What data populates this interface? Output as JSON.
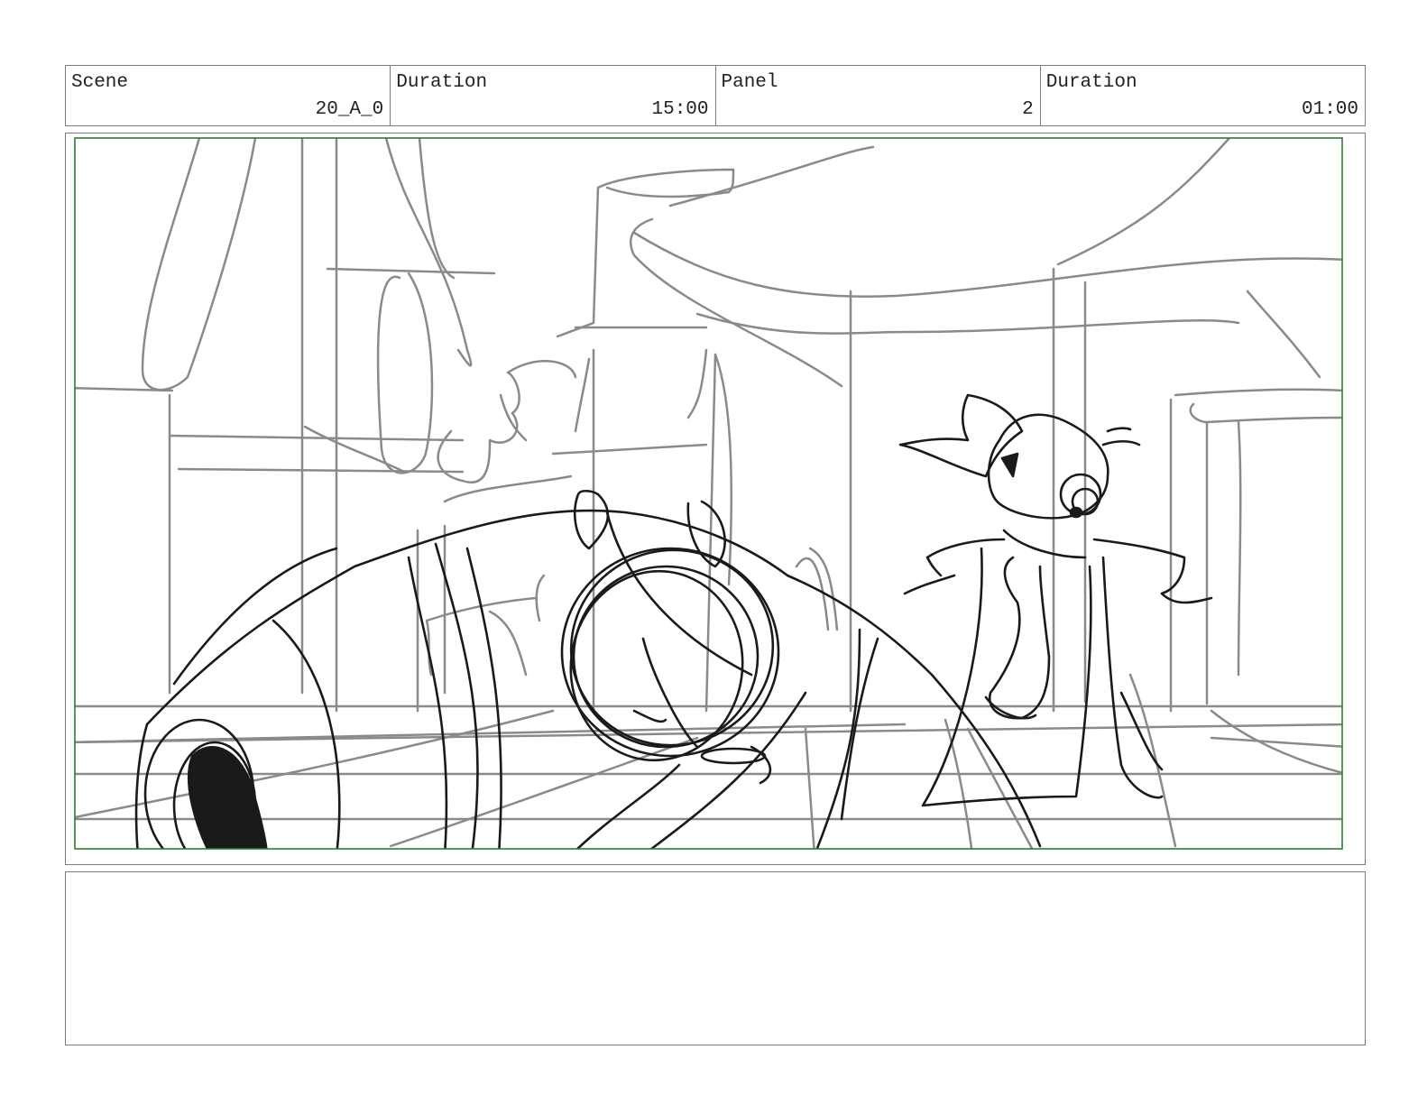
{
  "header": {
    "scene_label": "Scene",
    "scene_value": "20_A_0",
    "scene_duration_label": "Duration",
    "scene_duration_value": "15:00",
    "panel_label": "Panel",
    "panel_value": "2",
    "panel_duration_label": "Duration",
    "panel_duration_value": "01:00"
  },
  "notes": {
    "text": ""
  },
  "colors": {
    "safe_area": "#2e7d32",
    "sketch_dark": "#1a1a1a",
    "sketch_light": "#8a8a8a",
    "border": "#7a7a7a"
  }
}
